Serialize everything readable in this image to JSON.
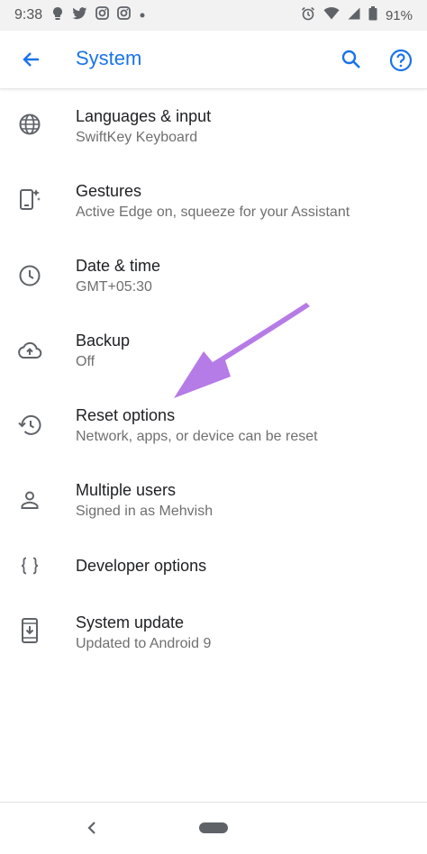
{
  "status_bar": {
    "time": "9:38",
    "battery_percent": "91%",
    "left_icons": [
      "bulb-icon",
      "twitter-icon",
      "instagram-icon",
      "instagram-icon",
      "dot-icon"
    ],
    "right_icons": [
      "alarm-icon",
      "wifi-icon",
      "signal-icon",
      "battery-icon"
    ]
  },
  "app_bar": {
    "title": "System",
    "accent_color": "#1a73e8"
  },
  "settings": [
    {
      "title": "Languages & input",
      "subtitle": "SwiftKey Keyboard",
      "icon": "globe-icon"
    },
    {
      "title": "Gestures",
      "subtitle": "Active Edge on, squeeze for your Assistant",
      "icon": "gestures-icon"
    },
    {
      "title": "Date & time",
      "subtitle": "GMT+05:30",
      "icon": "clock-icon"
    },
    {
      "title": "Backup",
      "subtitle": "Off",
      "icon": "cloud-upload-icon"
    },
    {
      "title": "Reset options",
      "subtitle": "Network, apps, or device can be reset",
      "icon": "history-icon"
    },
    {
      "title": "Multiple users",
      "subtitle": "Signed in as Mehvish",
      "icon": "person-icon"
    },
    {
      "title": "Developer options",
      "subtitle": "",
      "icon": "braces-icon"
    },
    {
      "title": "System update",
      "subtitle": "Updated to Android 9",
      "icon": "system-update-icon"
    }
  ],
  "annotation": {
    "arrow_color": "#b57be6",
    "points_to": "Reset options"
  }
}
